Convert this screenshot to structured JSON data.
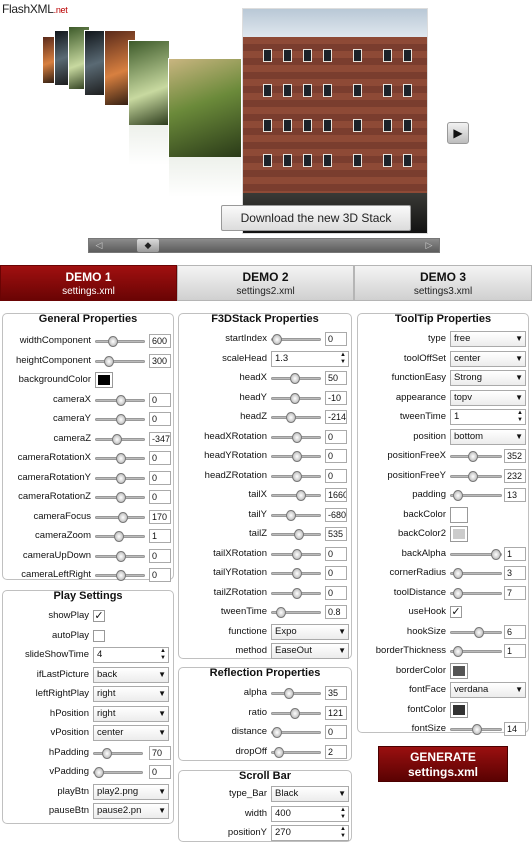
{
  "brand": {
    "name": "FlashXML",
    "tld": ".net"
  },
  "gallery": {
    "tooltip": "Download the new 3D Stack",
    "next_icon": "play-icon",
    "scroll_left": "◁",
    "scroll_right": "▷",
    "scroll_thumb": "◆"
  },
  "tabs": [
    {
      "label": "DEMO 1",
      "file": "settings.xml",
      "active": true
    },
    {
      "label": "DEMO 2",
      "file": "settings2.xml",
      "active": false
    },
    {
      "label": "DEMO 3",
      "file": "settings3.xml",
      "active": false
    }
  ],
  "general": {
    "title": "General Properties",
    "rows": [
      {
        "label": "widthComponent",
        "type": "slider",
        "value": "600",
        "level": 0.3
      },
      {
        "label": "heightComponent",
        "type": "slider",
        "value": "300",
        "level": 0.2
      },
      {
        "label": "backgroundColor",
        "type": "color",
        "color": "#000000"
      },
      {
        "label": "cameraX",
        "type": "slider",
        "value": "0",
        "level": 0.5
      },
      {
        "label": "cameraY",
        "type": "slider",
        "value": "0",
        "level": 0.5
      },
      {
        "label": "cameraZ",
        "type": "slider",
        "value": "-347",
        "level": 0.4
      },
      {
        "label": "cameraRotationX",
        "type": "slider",
        "value": "0",
        "level": 0.5
      },
      {
        "label": "cameraRotationY",
        "type": "slider",
        "value": "0",
        "level": 0.5
      },
      {
        "label": "cameraRotationZ",
        "type": "slider",
        "value": "0",
        "level": 0.5
      },
      {
        "label": "cameraFocus",
        "type": "slider",
        "value": "170",
        "level": 0.55
      },
      {
        "label": "cameraZoom",
        "type": "slider",
        "value": "1",
        "level": 0.45
      },
      {
        "label": "cameraUpDown",
        "type": "slider",
        "value": "0",
        "level": 0.5
      },
      {
        "label": "cameraLeftRight",
        "type": "slider",
        "value": "0",
        "level": 0.5
      }
    ]
  },
  "play": {
    "title": "Play Settings",
    "rows": [
      {
        "label": "showPlay",
        "type": "check",
        "checked": true
      },
      {
        "label": "autoPlay",
        "type": "check",
        "checked": false
      },
      {
        "label": "slideShowTime",
        "type": "spin",
        "value": "4"
      },
      {
        "label": "ifLastPicture",
        "type": "select",
        "value": "back"
      },
      {
        "label": "leftRightPlay",
        "type": "select",
        "value": "right"
      },
      {
        "label": "hPosition",
        "type": "select",
        "value": "right"
      },
      {
        "label": "vPosition",
        "type": "select",
        "value": "center"
      },
      {
        "label": "hPadding",
        "type": "slider",
        "value": "70",
        "level": 0.2
      },
      {
        "label": "vPadding",
        "type": "slider",
        "value": "0",
        "level": 0.0
      },
      {
        "label": "playBtn",
        "type": "select",
        "value": "play2.png"
      },
      {
        "label": "pauseBtn",
        "type": "select",
        "value": "pause2.pn"
      }
    ]
  },
  "f3d": {
    "title": "F3DStack Properties",
    "rows": [
      {
        "label": "startIndex",
        "type": "slider",
        "value": "0",
        "level": 0.0
      },
      {
        "label": "scaleHead",
        "type": "spin",
        "value": "1.3"
      },
      {
        "label": "headX",
        "type": "slider",
        "value": "50",
        "level": 0.45
      },
      {
        "label": "headY",
        "type": "slider",
        "value": "-10",
        "level": 0.45
      },
      {
        "label": "headZ",
        "type": "slider",
        "value": "-214",
        "level": 0.35
      },
      {
        "label": "headXRotation",
        "type": "slider",
        "value": "0",
        "level": 0.5
      },
      {
        "label": "headYRotation",
        "type": "slider",
        "value": "0",
        "level": 0.5
      },
      {
        "label": "headZRotation",
        "type": "slider",
        "value": "0",
        "level": 0.5
      },
      {
        "label": "tailX",
        "type": "slider",
        "value": "1660",
        "level": 0.6
      },
      {
        "label": "tailY",
        "type": "slider",
        "value": "-680",
        "level": 0.35
      },
      {
        "label": "tailZ",
        "type": "slider",
        "value": "535",
        "level": 0.55
      },
      {
        "label": "tailXRotation",
        "type": "slider",
        "value": "0",
        "level": 0.5
      },
      {
        "label": "tailYRotation",
        "type": "slider",
        "value": "0",
        "level": 0.5
      },
      {
        "label": "tailZRotation",
        "type": "slider",
        "value": "0",
        "level": 0.5
      },
      {
        "label": "tweenTime",
        "type": "slider",
        "value": "0.8",
        "level": 0.1
      },
      {
        "label": "functione",
        "type": "select",
        "value": "Expo"
      },
      {
        "label": "method",
        "type": "select",
        "value": "EaseOut"
      }
    ]
  },
  "reflection": {
    "title": "Reflection Properties",
    "rows": [
      {
        "label": "alpha",
        "type": "slider",
        "value": "35",
        "level": 0.3
      },
      {
        "label": "ratio",
        "type": "slider",
        "value": "121",
        "level": 0.45
      },
      {
        "label": "distance",
        "type": "slider",
        "value": "0",
        "level": 0.0
      },
      {
        "label": "dropOff",
        "type": "slider",
        "value": "2",
        "level": 0.05
      }
    ]
  },
  "scrollbar_panel": {
    "title": "Scroll Bar",
    "rows": [
      {
        "label": "type_Bar",
        "type": "select",
        "value": "Black"
      },
      {
        "label": "width",
        "type": "spin",
        "value": "400"
      },
      {
        "label": "positionY",
        "type": "spin",
        "value": "270"
      }
    ]
  },
  "tooltip_props": {
    "title": "ToolTip Properties",
    "rows": [
      {
        "label": "type",
        "type": "select",
        "value": "free"
      },
      {
        "label": "toolOffSet",
        "type": "select",
        "value": "center"
      },
      {
        "label": "functionEasy",
        "type": "select",
        "value": "Strong"
      },
      {
        "label": "appearance",
        "type": "select",
        "value": "topv"
      },
      {
        "label": "tweenTime",
        "type": "spin",
        "value": "1"
      },
      {
        "label": "position",
        "type": "select",
        "value": "bottom"
      },
      {
        "label": "positionFreeX",
        "type": "slider",
        "value": "352",
        "level": 0.4
      },
      {
        "label": "positionFreeY",
        "type": "slider",
        "value": "232",
        "level": 0.4
      },
      {
        "label": "padding",
        "type": "slider",
        "value": "13",
        "level": 0.05
      },
      {
        "label": "backColor",
        "type": "color",
        "color": "#ffffff"
      },
      {
        "label": "backColor2",
        "type": "color",
        "color": "#cccccc"
      },
      {
        "label": "backAlpha",
        "type": "slider",
        "value": "1",
        "level": 0.95
      },
      {
        "label": "cornerRadius",
        "type": "slider",
        "value": "3",
        "level": 0.05
      },
      {
        "label": "toolDistance",
        "type": "slider",
        "value": "7",
        "level": 0.05
      },
      {
        "label": "useHook",
        "type": "check",
        "checked": true
      },
      {
        "label": "hookSize",
        "type": "slider",
        "value": "6",
        "level": 0.55
      },
      {
        "label": "borderThickness",
        "type": "slider",
        "value": "1",
        "level": 0.05
      },
      {
        "label": "borderColor",
        "type": "color",
        "color": "#555555"
      },
      {
        "label": "fontFace",
        "type": "select",
        "value": "verdana"
      },
      {
        "label": "fontColor",
        "type": "color",
        "color": "#333333"
      },
      {
        "label": "fontSize",
        "type": "slider",
        "value": "14",
        "level": 0.5
      }
    ]
  },
  "generate": {
    "line1": "GENERATE",
    "line2": "settings.xml"
  }
}
